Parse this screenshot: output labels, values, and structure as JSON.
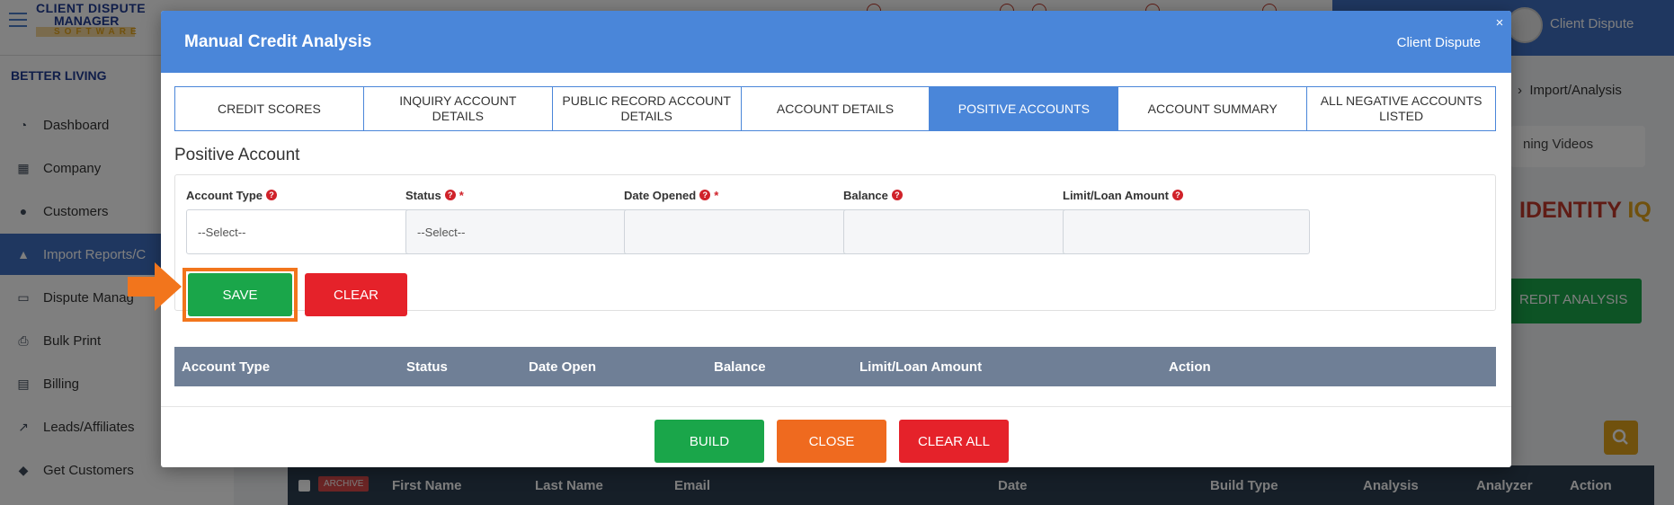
{
  "app": {
    "logo_line1": "CLIENT DISPUTE",
    "logo_line2": "MANAGER",
    "logo_line3": "SOFTWARE",
    "user_name": "Client Dispute",
    "company_label": "BETTER LIVING",
    "breadcrumb_tail": "Import/Analysis",
    "training_select": "ning Videos",
    "identity_brand_red": "IDENTITY",
    "identity_brand_gold": "IQ",
    "credit_analysis_button": "REDIT ANALYSIS",
    "grid_headers": [
      "First Name",
      "Last Name",
      "Email",
      "Date",
      "Build Type",
      "Analysis",
      "Analyzer",
      "Action"
    ],
    "archive_badge": "ARCHIVE"
  },
  "sidebar": {
    "items": [
      {
        "label": "Dashboard",
        "icon": "pie-chart-icon"
      },
      {
        "label": "Company",
        "icon": "building-icon"
      },
      {
        "label": "Customers",
        "icon": "users-icon"
      },
      {
        "label": "Import Reports/C",
        "icon": "file-upload-icon",
        "active": true
      },
      {
        "label": "Dispute Manag",
        "icon": "laptop-icon"
      },
      {
        "label": "Bulk Print",
        "icon": "printer-icon"
      },
      {
        "label": "Billing",
        "icon": "invoice-icon"
      },
      {
        "label": "Leads/Affiliates",
        "icon": "chart-line-icon"
      },
      {
        "label": "Get Customers",
        "icon": "graduation-cap-icon"
      }
    ]
  },
  "modal": {
    "title": "Manual Credit Analysis",
    "brand": "Client Dispute",
    "close_symbol": "×",
    "tabs": [
      {
        "label": "CREDIT SCORES"
      },
      {
        "label": "INQUIRY ACCOUNT DETAILS"
      },
      {
        "label": "PUBLIC RECORD ACCOUNT DETAILS"
      },
      {
        "label": "ACCOUNT DETAILS"
      },
      {
        "label": "POSITIVE ACCOUNTS",
        "active": true
      },
      {
        "label": "ACCOUNT SUMMARY"
      },
      {
        "label": "ALL NEGATIVE ACCOUNTS LISTED"
      }
    ],
    "section_title": "Positive Account",
    "form": {
      "account_type": {
        "label": "Account Type",
        "value": "--Select--",
        "required": false
      },
      "status": {
        "label": "Status",
        "value": "--Select--",
        "required": true
      },
      "date_opened": {
        "label": "Date Opened",
        "value": "",
        "required": true
      },
      "balance": {
        "label": "Balance",
        "value": ""
      },
      "limit_loan_amount": {
        "label": "Limit/Loan Amount",
        "value": ""
      }
    },
    "help_symbol": "?",
    "required_marker": "*",
    "save_label": "SAVE",
    "clear_label": "CLEAR",
    "table_headers": [
      "Account Type",
      "Status",
      "Date Open",
      "Balance",
      "Limit/Loan Amount",
      "Action"
    ],
    "build_label": "BUILD",
    "close_label": "CLOSE",
    "clear_all_label": "CLEAR ALL"
  },
  "colors": {
    "header_blue": "#4a86d9",
    "save_green": "#1aa64a",
    "clear_red": "#e5222a",
    "close_orange": "#ef6a1f",
    "highlight_orange": "#f2751c",
    "table_header": "#6f7f96"
  }
}
